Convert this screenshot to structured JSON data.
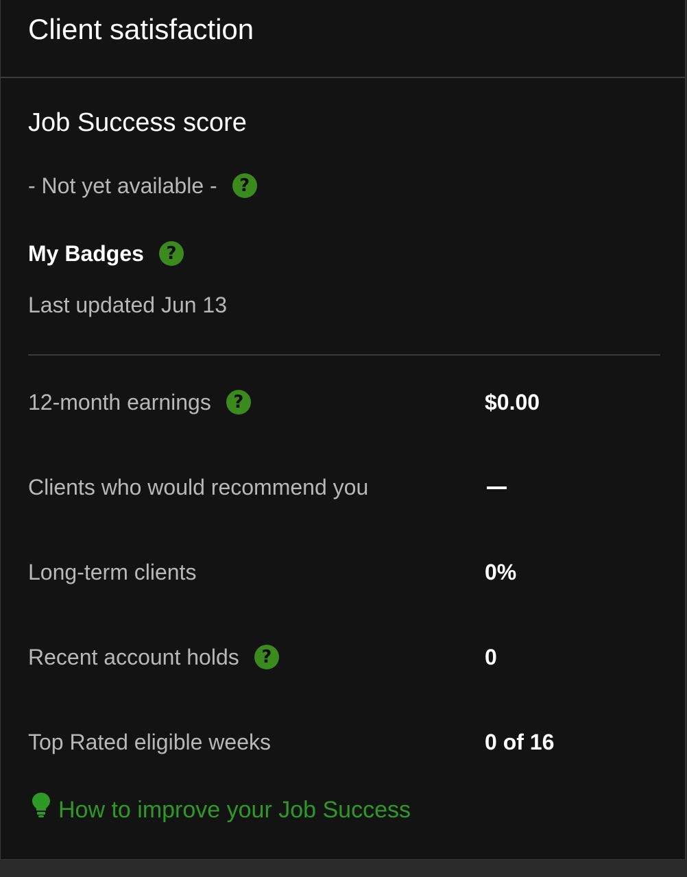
{
  "header": {
    "title": "Client satisfaction"
  },
  "job_success": {
    "title": "Job Success score",
    "status": "- Not yet available -",
    "status_help_icon": "question-circle-icon"
  },
  "badges": {
    "title": "My Badges",
    "help_icon": "question-circle-icon",
    "last_updated": "Last updated Jun 13"
  },
  "stats": [
    {
      "label": "12-month earnings",
      "value": "$0.00",
      "has_help": true
    },
    {
      "label": "Clients who would recommend you",
      "value": "—",
      "has_help": false
    },
    {
      "label": "Long-term clients",
      "value": "0%",
      "has_help": false
    },
    {
      "label": "Recent account holds",
      "value": "0",
      "has_help": true
    },
    {
      "label": "Top Rated eligible weeks",
      "value": "0 of 16",
      "has_help": false
    }
  ],
  "improve_link": {
    "label": "How to improve your Job Success",
    "icon": "lightbulb-icon"
  },
  "colors": {
    "background": "#131313",
    "accent_green": "#3a8a1e",
    "link_green": "#2e9a26",
    "muted_text": "#b8b8b8",
    "divider": "#3a3a3a"
  }
}
